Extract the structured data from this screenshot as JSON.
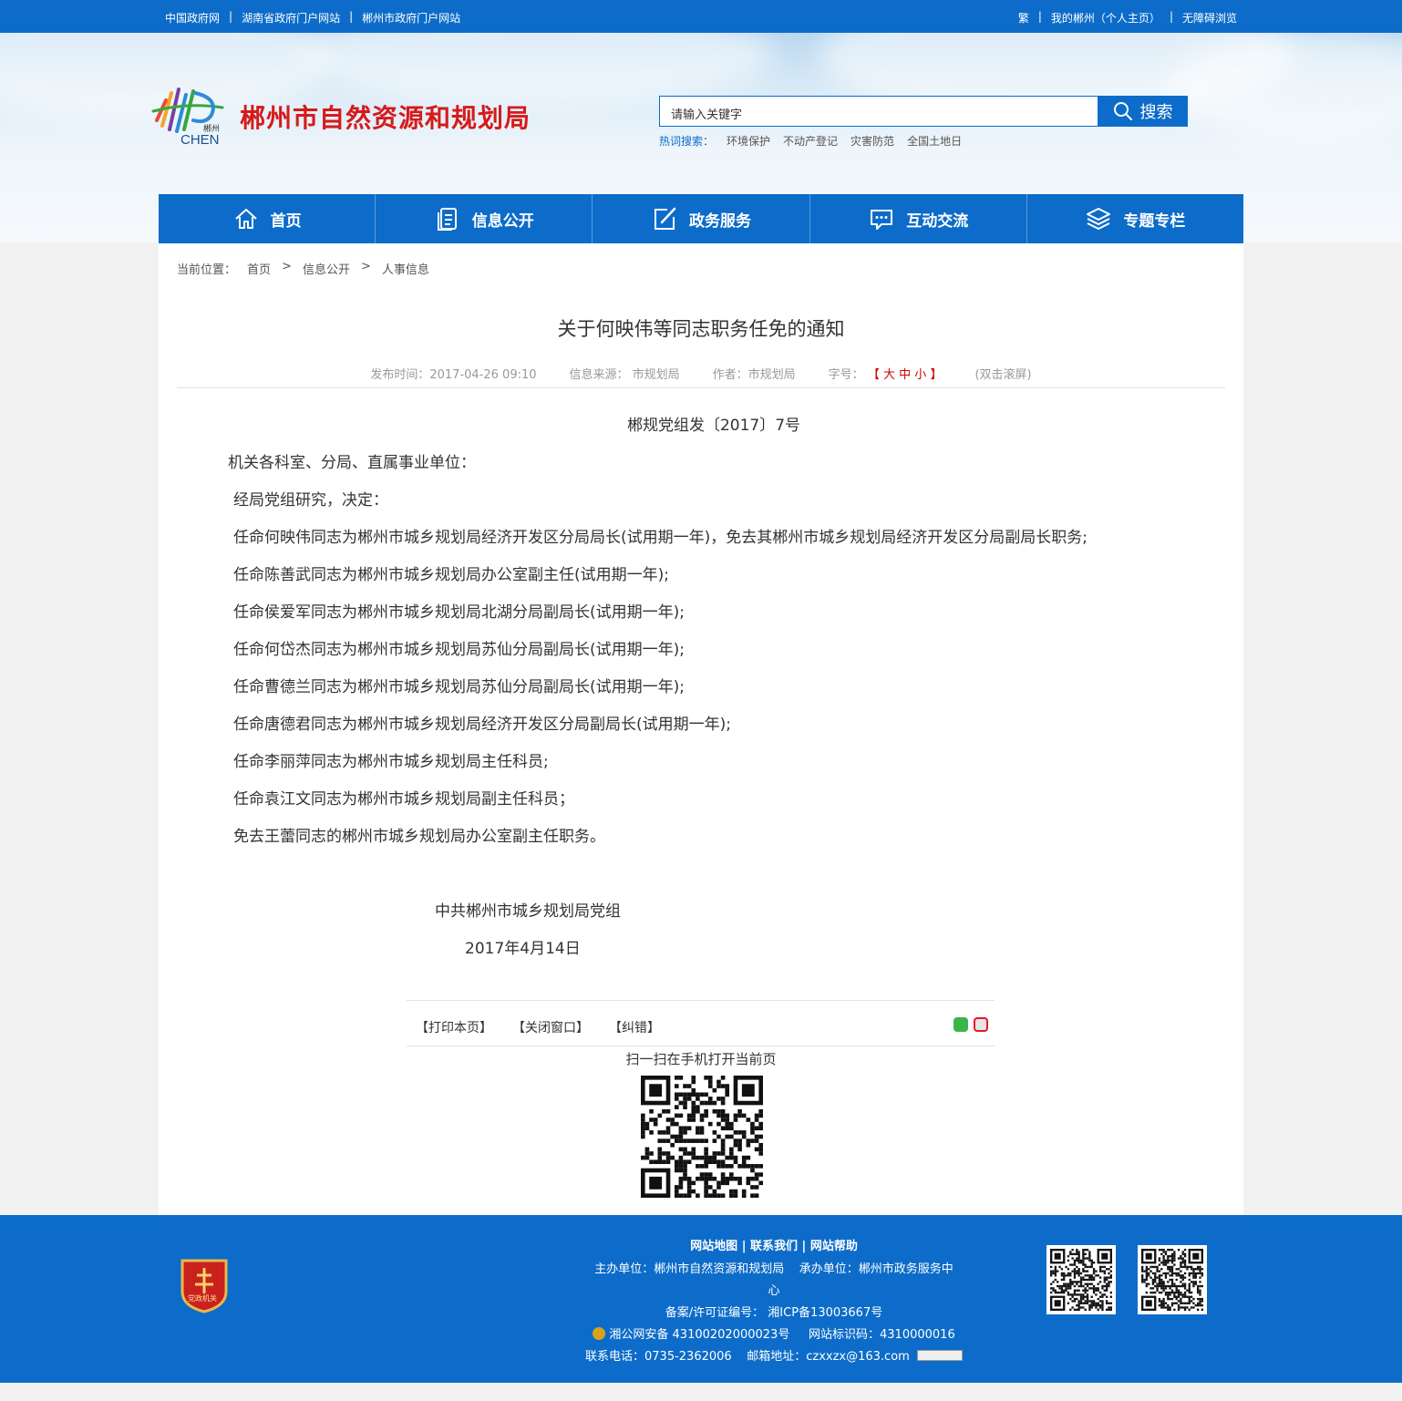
{
  "topbar": {
    "links_left": [
      "中国政府网",
      "湖南省政府门户网站",
      "郴州市政府门户网站"
    ],
    "links_right": [
      "繁",
      "我的郴州（个人主页）",
      "无障碍浏览"
    ],
    "separator": "|"
  },
  "header": {
    "logo_text": "CHEN",
    "logo_small": "郴州",
    "site_title": "郴州市自然资源和规划局",
    "search_placeholder": "请输入关键字",
    "search_button": "搜索",
    "hot_label": "热词搜索：",
    "hot_words": [
      "环境保护",
      "不动产登记",
      "灾害防范",
      "全国土地日"
    ]
  },
  "nav": [
    {
      "label": "首页",
      "icon": "home-icon"
    },
    {
      "label": "信息公开",
      "icon": "document-icon"
    },
    {
      "label": "政务服务",
      "icon": "edit-icon"
    },
    {
      "label": "互动交流",
      "icon": "chat-icon"
    },
    {
      "label": "专题专栏",
      "icon": "layers-icon"
    }
  ],
  "breadcrumb": {
    "label": "当前位置：",
    "items": [
      "首页",
      "信息公开",
      "人事信息"
    ],
    "separator": ">"
  },
  "article": {
    "title": "关于何映伟等同志职务任免的通知",
    "meta": {
      "publish": "发布时间：2017-04-26 09:10",
      "source": "信息来源： 市规划局",
      "author": "作者：市规划局",
      "font_label": "字号：",
      "bracket_open": "【",
      "big": "大",
      "mid": "中",
      "small": "小",
      "bracket_close": "】",
      "scroll": "(双击滚屏)"
    },
    "doc_no": "郴规党组发〔2017〕7号",
    "salutation": "机关各科室、分局、直属事业单位：",
    "paragraphs": [
      "经局党组研究，决定：",
      "任命何映伟同志为郴州市城乡规划局经济开发区分局局长(试用期一年)，免去其郴州市城乡规划局经济开发区分局副局长职务;",
      "任命陈善武同志为郴州市城乡规划局办公室副主任(试用期一年);",
      "任命侯爱军同志为郴州市城乡规划局北湖分局副局长(试用期一年);",
      "任命何岱杰同志为郴州市城乡规划局苏仙分局副局长(试用期一年);",
      "任命曹德兰同志为郴州市城乡规划局苏仙分局副局长(试用期一年);",
      "任命唐德君同志为郴州市城乡规划局经济开发区分局副局长(试用期一年);",
      "任命李丽萍同志为郴州市城乡规划局主任科员;",
      "任命袁江文同志为郴州市城乡规划局副主任科员；",
      "免去王蕾同志的郴州市城乡规划局办公室副主任职务。"
    ],
    "signature_org": "中共郴州市城乡规划局党组",
    "signature_date": "2017年4月14日"
  },
  "tools": {
    "print": "【打印本页】",
    "close": "【关闭窗口】",
    "correct": "【纠错】",
    "share_icons": [
      "wechat-icon",
      "weibo-icon"
    ],
    "qr_caption": "扫一扫在手机打开当前页"
  },
  "footer": {
    "links": [
      "网站地图",
      "联系我们",
      "网站帮助"
    ],
    "host": "主办单位：郴州市自然资源和规划局",
    "organizer_a": "承办单位：郴州市政务服务中",
    "organizer_b": "心",
    "icp": "备案/许可证编号： 湘ICP备13003667号",
    "police": "湘公网安备 43100202000023号",
    "site_code": "网站标识码：4310000016",
    "phone": "联系电话：0735-2362006",
    "email": "邮箱地址：czxxzx@163.com",
    "badge_text": "党政机关",
    "colors": {
      "primary": "#0d6cc9",
      "title_red": "#d61a1a"
    }
  }
}
